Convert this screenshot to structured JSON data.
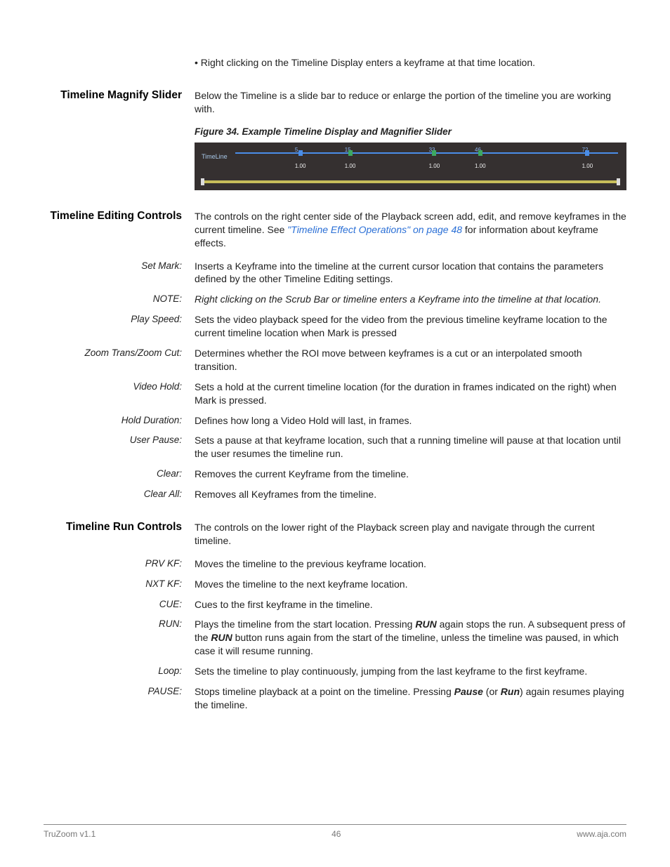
{
  "bullet1": "Right clicking on the Timeline Display enters a keyframe at that time location.",
  "magnify": {
    "heading": "Timeline Magnify Slider",
    "body": "Below the Timeline is a slide bar to reduce or enlarge the portion of the timeline you are working with."
  },
  "figure": {
    "caption": "Figure 34. Example Timeline Display and Magnifier Slider",
    "label": "TimeLine",
    "ticks": [
      {
        "pos": 17,
        "num": "5",
        "val": "1.00"
      },
      {
        "pos": 30,
        "num": "15",
        "val": "1.00"
      },
      {
        "pos": 52,
        "num": "33",
        "val": "1.00"
      },
      {
        "pos": 64,
        "num": "46",
        "val": "1.00"
      },
      {
        "pos": 92,
        "num": "72",
        "val": "1.00"
      }
    ]
  },
  "editing": {
    "heading": "Timeline Editing Controls",
    "intro_a": "The controls on the right center side of the Playback screen add, edit, and remove keyframes in the current timeline. See ",
    "intro_link": "\"Timeline Effect Operations\" on page 48",
    "intro_b": " for information about keyframe effects.",
    "items": [
      {
        "term": "Set Mark:",
        "body": "Inserts a Keyframe into the timeline at the current cursor location that contains the parameters defined by the other Timeline Editing settings."
      },
      {
        "term": "NOTE:",
        "body": "Right clicking on the Scrub Bar or timeline enters a Keyframe into the timeline at that location.",
        "note": true
      },
      {
        "term": "Play Speed:",
        "body": "Sets the video playback speed for the video from the previous timeline keyframe location to the current timeline location when Mark is pressed"
      },
      {
        "term": "Zoom Trans/Zoom Cut:",
        "body": "Determines whether the ROI move between keyframes is a cut or an interpolated smooth transition."
      },
      {
        "term": "Video Hold:",
        "body": "Sets a hold at the current timeline location (for the duration in frames indicated on the right) when Mark is pressed."
      },
      {
        "term": "Hold Duration:",
        "body": "Defines how long a Video Hold will last, in frames."
      },
      {
        "term": "User Pause:",
        "body": "Sets a pause at that keyframe location, such that a running timeline will pause at that location until the user resumes the timeline run."
      },
      {
        "term": "Clear:",
        "body": "Removes the current Keyframe from the timeline."
      },
      {
        "term": "Clear All:",
        "body": "Removes all Keyframes from the timeline."
      }
    ]
  },
  "run": {
    "heading": "Timeline Run Controls",
    "intro": "The controls on the lower right of the Playback screen play and navigate through the current timeline.",
    "items": [
      {
        "term": "PRV KF:",
        "body": "Moves the timeline to the previous keyframe location."
      },
      {
        "term": "NXT KF:",
        "body": "Moves the timeline to the next keyframe location."
      },
      {
        "term": "CUE:",
        "body": "Cues to the first keyframe in the timeline."
      },
      {
        "term": "RUN:",
        "body_parts": [
          "Plays the timeline from the start location. Pressing ",
          {
            "b": "RUN"
          },
          " again stops the run. A subsequent press of the ",
          {
            "b": "RUN"
          },
          " button runs again from the start of the timeline, unless the timeline was paused, in which case it will resume running."
        ]
      },
      {
        "term": "Loop:",
        "body": "Sets the timeline to play continuously, jumping from the last keyframe to the first keyframe."
      },
      {
        "term": "PAUSE:",
        "body_parts": [
          "Stops timeline playback at a point on the timeline. Pressing ",
          {
            "bi": "Pause"
          },
          " (or ",
          {
            "bi": "Run"
          },
          ") again resumes playing the timeline."
        ]
      }
    ]
  },
  "footer": {
    "left": "TruZoom v1.1",
    "center": "46",
    "right": "www.aja.com"
  }
}
